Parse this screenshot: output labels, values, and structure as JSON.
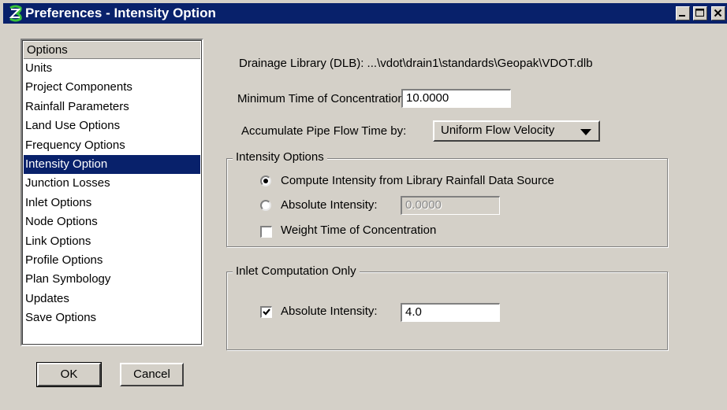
{
  "window": {
    "title": "Preferences - Intensity Option",
    "icon": "geopak-logo-icon"
  },
  "colors": {
    "titlebar": "#08216b",
    "selection": "#08216b",
    "face": "#d4d0c8"
  },
  "options_list": {
    "header": "Options",
    "items": [
      "Units",
      "Project Components",
      "Rainfall Parameters",
      "Land Use Options",
      "Frequency Options",
      "Intensity Option",
      "Junction Losses",
      "Inlet Options",
      "Node Options",
      "Link Options",
      "Profile Options",
      "Plan Symbology",
      "Updates",
      "Save Options"
    ],
    "selected": "Intensity Option"
  },
  "buttons": {
    "ok": "OK",
    "cancel": "Cancel"
  },
  "settings": {
    "drainage_library": "Drainage Library (DLB): ...\\vdot\\drain1\\standards\\Geopak\\VDOT.dlb",
    "min_time_label": "Minimum Time of Concentration:",
    "min_time_value": "10.0000",
    "accumulate_label": "Accumulate Pipe Flow Time by:",
    "accumulate_value": "Uniform Flow Velocity"
  },
  "intensity_options": {
    "title": "Intensity Options",
    "compute_label": "Compute Intensity from Library Rainfall Data Source",
    "compute_selected": true,
    "absolute_label": "Absolute Intensity:",
    "absolute_value": "0.0000",
    "absolute_selected": false,
    "weight_label": "Weight Time of Concentration",
    "weight_checked": false
  },
  "inlet_computation": {
    "title": "Inlet Computation Only",
    "absolute_label": "Absolute Intensity:",
    "absolute_checked": true,
    "absolute_value": "4.0"
  }
}
